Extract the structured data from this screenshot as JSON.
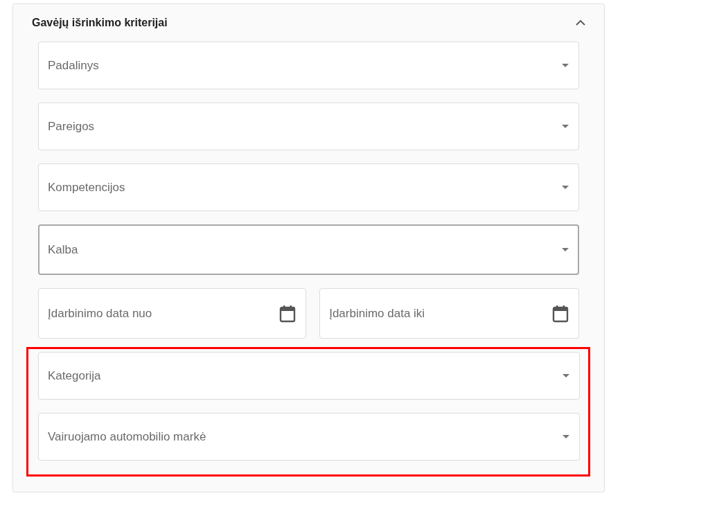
{
  "panel": {
    "title": "Gavėjų išrinkimo kriterijai",
    "expanded": true,
    "sections": [
      {
        "highlighted": false,
        "rows": [
          [
            {
              "kind": "select",
              "placeholder": "Padalinys",
              "hovered": false
            }
          ],
          [
            {
              "kind": "select",
              "placeholder": "Pareigos",
              "hovered": false
            }
          ],
          [
            {
              "kind": "select",
              "placeholder": "Kompetencijos",
              "hovered": false
            }
          ],
          [
            {
              "kind": "select",
              "placeholder": "Kalba",
              "hovered": true
            }
          ],
          [
            {
              "kind": "date",
              "placeholder": "Įdarbinimo data nuo",
              "hovered": false
            },
            {
              "kind": "date",
              "placeholder": "Įdarbinimo data iki",
              "hovered": false
            }
          ]
        ]
      },
      {
        "highlighted": true,
        "rows": [
          [
            {
              "kind": "select",
              "placeholder": "Kategorija",
              "hovered": false
            }
          ],
          [
            {
              "kind": "select",
              "placeholder": "Vairuojamo automobilio markė",
              "hovered": false
            }
          ]
        ]
      }
    ]
  }
}
